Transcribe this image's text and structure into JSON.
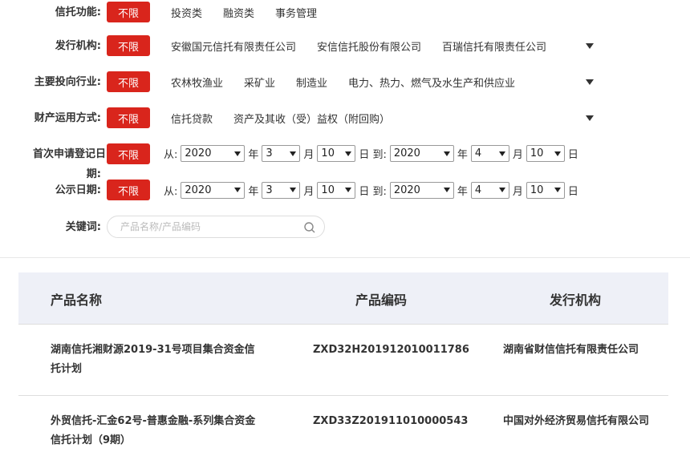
{
  "filters": {
    "trust_function": {
      "label": "信托功能:",
      "all": "不限",
      "options": [
        "投资类",
        "融资类",
        "事务管理"
      ]
    },
    "issuer": {
      "label": "发行机构:",
      "all": "不限",
      "options": [
        "安徽国元信托有限责任公司",
        "安信信托股份有限公司",
        "百瑞信托有限责任公司"
      ]
    },
    "industry": {
      "label": "主要投向行业:",
      "all": "不限",
      "options": [
        "农林牧渔业",
        "采矿业",
        "制造业",
        "电力、热力、燃气及水生产和供应业"
      ]
    },
    "property_use": {
      "label": "财产运用方式:",
      "all": "不限",
      "options": [
        "信托贷款",
        "资产及其收（受）益权（附回购）"
      ]
    },
    "first_registration": {
      "label_line1": "首次申请登记日",
      "label_line2": "期:",
      "all": "不限"
    },
    "publication_date": {
      "label": "公示日期:",
      "all": "不限"
    },
    "date_range": {
      "from": "从:",
      "to": "到:",
      "year_unit": "年",
      "month_unit": "月",
      "day_unit": "日",
      "start_year": "2020",
      "start_month": "3",
      "start_day": "10",
      "end_year": "2020",
      "end_month": "4",
      "end_day": "10"
    },
    "keyword": {
      "label": "关键词:",
      "placeholder": "产品名称/产品编码"
    }
  },
  "table": {
    "headers": {
      "name": "产品名称",
      "code": "产品编码",
      "issuer": "发行机构"
    },
    "rows": [
      {
        "name": "湖南信托湘财源2019-31号项目集合资金信托计划",
        "code": "ZXD32H201912010011786",
        "issuer": "湖南省财信信托有限责任公司"
      },
      {
        "name": "外贸信托-汇金62号-普惠金融-系列集合资金信托计划（9期）",
        "code": "ZXD33Z201911010000543",
        "issuer": "中国对外经济贸易信托有限公司"
      }
    ]
  },
  "colors": {
    "accent": "#d9251c",
    "header_bg": "#eef0f7"
  }
}
